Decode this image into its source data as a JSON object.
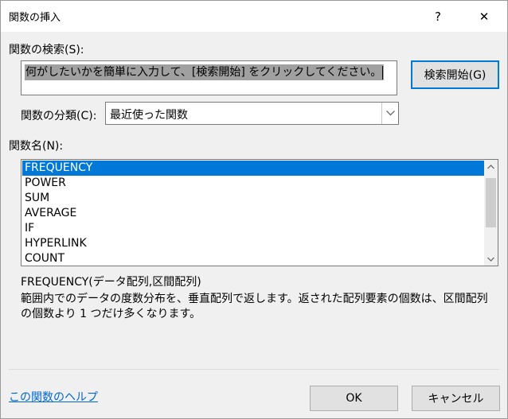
{
  "window": {
    "title": "関数の挿入",
    "help_glyph": "?",
    "close_glyph": "✕"
  },
  "search": {
    "label": "関数の検索(S):",
    "value": "何がしたいかを簡単に入力して、[検索開始] をクリックしてください。",
    "button_label": "検索開始(G)"
  },
  "category": {
    "label": "関数の分類(C):",
    "selected": "最近使った関数",
    "arrow_icon": "chevron-down-icon"
  },
  "function_list": {
    "label": "関数名(N):",
    "items": [
      "FREQUENCY",
      "POWER",
      "SUM",
      "AVERAGE",
      "IF",
      "HYPERLINK",
      "COUNT"
    ],
    "selected_index": 0
  },
  "details": {
    "syntax": "FREQUENCY(データ配列,区間配列)",
    "description": "範囲内でのデータの度数分布を、垂直配列で返します。返された配列要素の個数は、区間配列の個数より 1 つだけ多くなります。"
  },
  "footer": {
    "help_link": "この関数のヘルプ",
    "ok_label": "OK",
    "cancel_label": "キャンセル"
  },
  "colors": {
    "accent": "#0078d7",
    "link": "#0066cc",
    "dialog_bg": "#f0f0f0"
  }
}
